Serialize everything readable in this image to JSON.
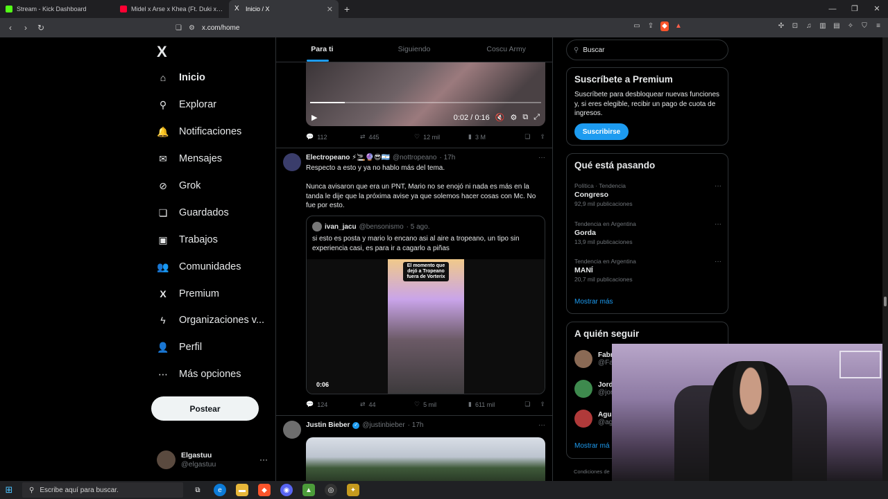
{
  "browser": {
    "tabs": [
      {
        "label": "Stream - Kick Dashboard",
        "color": "#53fc18"
      },
      {
        "label": "Midel x Arse x Khea (Ft. Duki x Klave)",
        "color": "#ff0033"
      },
      {
        "label": "Inicio / X",
        "color": "#ffffff"
      }
    ],
    "new_tab": "+",
    "url": "x.com/home"
  },
  "sidebar": {
    "logo": "X",
    "items": [
      {
        "label": "Inicio",
        "icon": "home-icon",
        "glyph": "⌂"
      },
      {
        "label": "Explorar",
        "icon": "search-icon",
        "glyph": "⚲"
      },
      {
        "label": "Notificaciones",
        "icon": "bell-icon",
        "glyph": "🔔"
      },
      {
        "label": "Mensajes",
        "icon": "mail-icon",
        "glyph": "✉"
      },
      {
        "label": "Grok",
        "icon": "grok-icon",
        "glyph": "⊘"
      },
      {
        "label": "Guardados",
        "icon": "bookmark-icon",
        "glyph": "❏"
      },
      {
        "label": "Trabajos",
        "icon": "briefcase-icon",
        "glyph": "▣"
      },
      {
        "label": "Comunidades",
        "icon": "people-icon",
        "glyph": "👥"
      },
      {
        "label": "Premium",
        "icon": "x-premium-icon",
        "glyph": "X"
      },
      {
        "label": "Organizaciones v...",
        "icon": "lightning-icon",
        "glyph": "ϟ"
      },
      {
        "label": "Perfil",
        "icon": "person-icon",
        "glyph": "👤"
      },
      {
        "label": "Más opciones",
        "icon": "more-circle-icon",
        "glyph": "⋯"
      }
    ],
    "post_label": "Postear",
    "user": {
      "name": "Elgastuu",
      "handle": "@elgastuu",
      "more": "···"
    }
  },
  "timeline": {
    "tabs": [
      "Para ti",
      "Siguiendo",
      "Coscu Army"
    ],
    "video1": {
      "time": "0:02 / 0:16",
      "progress": 0.15
    },
    "post1_stats": {
      "replies": "112",
      "reposts": "445",
      "likes": "12 mil",
      "views": "3 M"
    },
    "post2": {
      "name": "Electropeano ⚡🚬🔮😎🇦🇷",
      "handle": "@nottropeano",
      "time": "· 17h",
      "more": "···",
      "text1": "Respecto a esto y ya no hablo más del tema.",
      "text2": "Nunca avisaron que era un PNT, Mario no se enojó ni nada es más en la tanda le dije que la próxima avise ya que solemos hacer cosas con Mc. No fue por esto.",
      "quote": {
        "name": "ivan_jacu",
        "handle": "@bensonismo",
        "time": "· 5 ago.",
        "text": "si esto es posta y mario lo encano asi al aire a tropeano, un tipo sin experiencia casi, es para ir a cagarlo a piñas",
        "thumb_caption": "El momento que dejó a Tropeano fuera de Vorterix",
        "duration": "0:06"
      },
      "stats": {
        "replies": "124",
        "reposts": "44",
        "likes": "5 mil",
        "views": "611 mil"
      }
    },
    "post3": {
      "name": "Justin Bieber",
      "handle": "@justinbieber",
      "time": "· 17h",
      "more": "···"
    }
  },
  "right": {
    "search_placeholder": "Buscar",
    "premium": {
      "title": "Suscríbete a Premium",
      "text": "Suscríbete para desbloquear nuevas funciones y, si eres elegible, recibir un pago de cuota de ingresos.",
      "button": "Suscribirse"
    },
    "trends": {
      "title": "Qué está pasando",
      "items": [
        {
          "context": "Política · Tendencia",
          "name": "Congreso",
          "count": "92,9 mil publicaciones"
        },
        {
          "context": "Tendencia en Argentina",
          "name": "Gorda",
          "count": "13,9 mil publicaciones"
        },
        {
          "context": "Tendencia en Argentina",
          "name": "MANÍ",
          "count": "20,7 mil publicaciones"
        }
      ],
      "show_more": "Mostrar más"
    },
    "follow": {
      "title": "A quién seguir",
      "items": [
        {
          "name": "Fabr",
          "handle": "@Fat"
        },
        {
          "name": "Jordi",
          "handle": "@jor"
        },
        {
          "name": "Agus",
          "handle": "@agi"
        }
      ],
      "show_more": "Mostrar má"
    },
    "footer": "Condiciones de"
  },
  "taskbar": {
    "search_placeholder": "Escribe aquí para buscar."
  }
}
